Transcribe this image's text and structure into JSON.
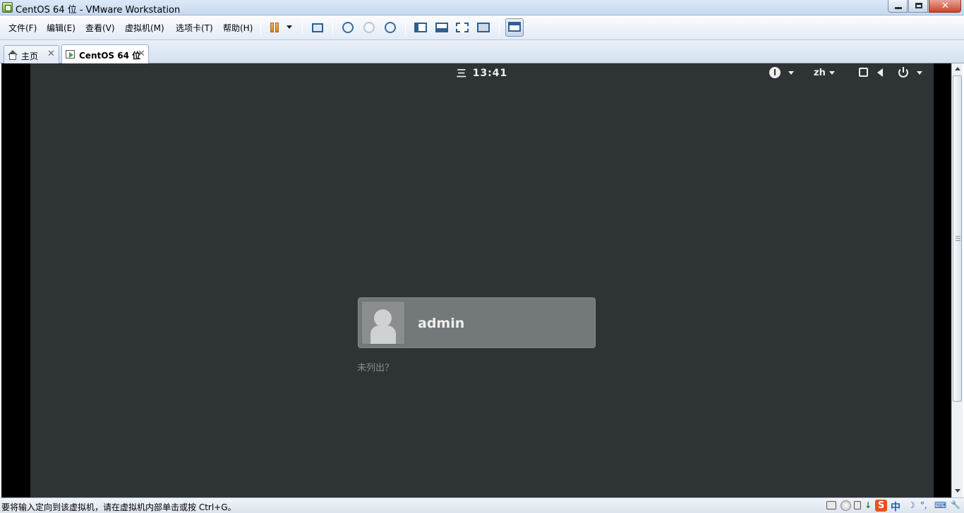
{
  "window": {
    "title": "CentOS 64 位 - VMware Workstation",
    "close_glyph": "✕"
  },
  "menu": {
    "items": [
      "文件(F)",
      "编辑(E)",
      "查看(V)",
      "虚拟机(M)",
      "选项卡(T)",
      "帮助(H)"
    ]
  },
  "toolbar": {
    "icons": [
      "pause-icon",
      "send-ctrl-alt-del-icon",
      "snapshot-icon",
      "revert-snapshot-icon",
      "snapshot-manager-icon",
      "show-library-icon",
      "quick-switch-icon",
      "full-screen-icon",
      "unity-icon",
      "console-view-icon"
    ]
  },
  "tabs": [
    {
      "label": "主页",
      "close": "✕",
      "icon": "home-icon"
    },
    {
      "label": "CentOS 64 位",
      "close": "✕",
      "icon": "vm-icon"
    }
  ],
  "gnome": {
    "clock_prefix": "三",
    "clock": "13:41",
    "language": "zh",
    "user": {
      "name": "admin"
    },
    "not_listed": "未列出？",
    "background": "#2e3436"
  },
  "status": {
    "text": "要将输入定向到该虚拟机，请在虚拟机内部单击或按 Ctrl+G。",
    "ime_s": "S",
    "ime_zh": "中",
    "moon": "☽",
    "dots": "°,",
    "keyboard": "⌨",
    "wrench": "🔧"
  }
}
